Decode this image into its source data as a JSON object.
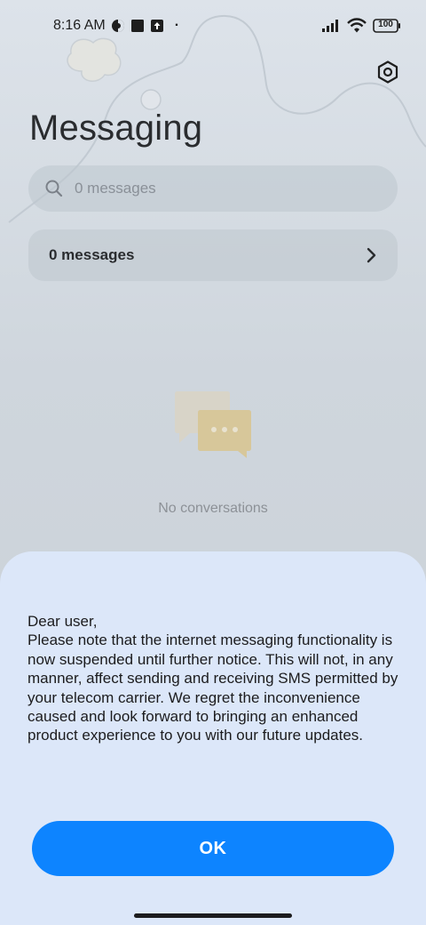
{
  "status_bar": {
    "time": "8:16 AM",
    "battery": "100",
    "dot": "·",
    "icons": [
      "vpn-icon",
      "square-notification-icon",
      "upload-icon",
      "signal-icon",
      "wifi-icon",
      "battery-icon"
    ]
  },
  "header": {
    "title": "Messaging",
    "settings_icon": "settings-icon"
  },
  "search": {
    "placeholder": "0 messages"
  },
  "messages_row": {
    "label": "0 messages"
  },
  "empty_state": {
    "text": "No conversations"
  },
  "dialog": {
    "greeting": "Dear user,",
    "body": "Please note that the internet messaging functionality is now suspended until further notice. This will not, in any manner, affect sending and receiving SMS permitted by your telecom carrier. We regret the inconvenience caused and look forward to bringing an enhanced product experience to you with our future updates.",
    "ok_label": "OK"
  },
  "colors": {
    "accent": "#0d84ff",
    "dialog_bg": "#dce7f9",
    "text_primary": "#2a2c2f",
    "text_secondary": "#8d9197"
  }
}
